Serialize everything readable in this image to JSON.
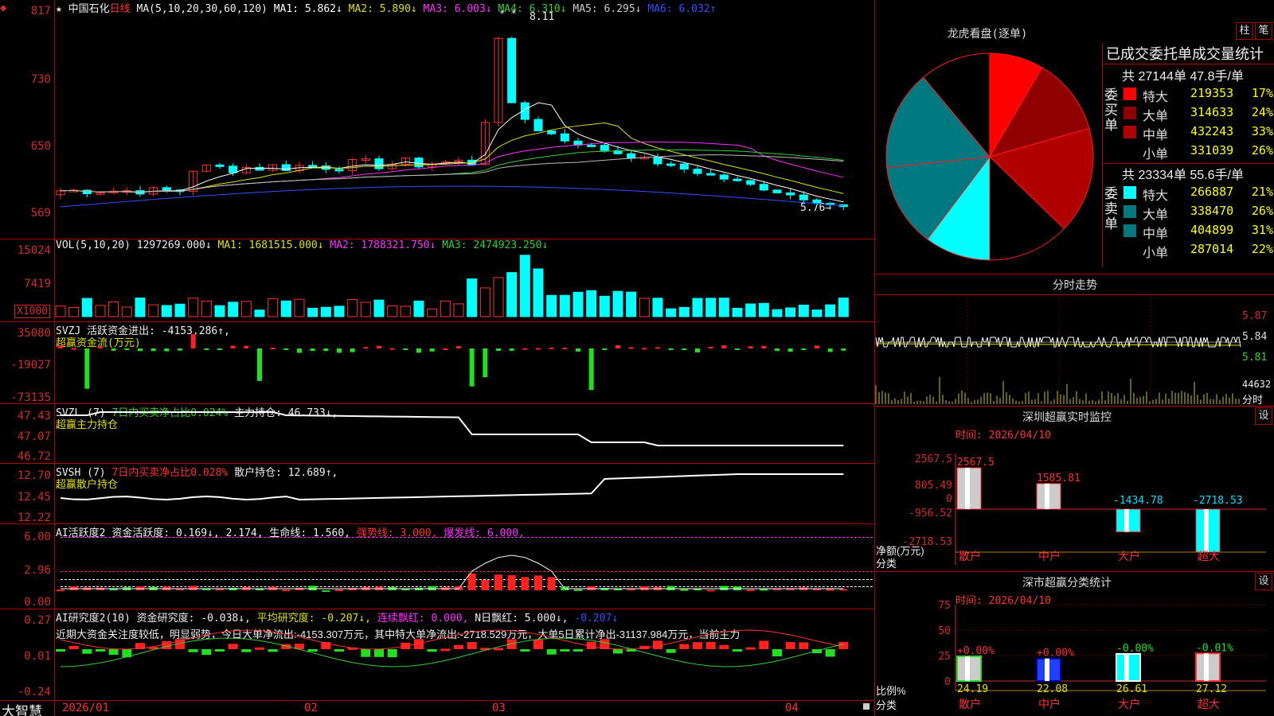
{
  "header": {
    "star": "★",
    "stock_name": "中国石化",
    "period": "日线",
    "ma_params": "MA(5,10,20,30,60,120)",
    "ma": [
      {
        "label": "MA1:",
        "value": "5.862↓",
        "color": "#ffffff"
      },
      {
        "label": "MA2:",
        "value": "5.890↓",
        "color": "#e0e000"
      },
      {
        "label": "MA3:",
        "value": "6.003↓",
        "color": "#ff30ff"
      },
      {
        "label": "MA4:",
        "value": "6.310↓",
        "color": "#30d030"
      },
      {
        "label": "MA5:",
        "value": "6.295↓",
        "color": "#cccccc"
      },
      {
        "label": "MA6:",
        "value": "6.032↑",
        "color": "#3050ff"
      }
    ],
    "high_label": "8.11",
    "low_label": "5.76→",
    "stars": "* *"
  },
  "price_axis": [
    "817",
    "730",
    "650",
    "569"
  ],
  "volume": {
    "header": "VOL(5,10,20)",
    "value": "1297269.000↓",
    "ma1": "MA1: 1681515.000↓",
    "ma2": "MA2: 1788321.750↓",
    "ma3": "MA3: 2474923.250↓",
    "axis": [
      "15024",
      "7419"
    ],
    "unit": "X1000"
  },
  "svzj": {
    "name": "SVZJ",
    "label": "活跃资金进出:",
    "value": "-4153.286↑,",
    "sub": "超赢资金流(万元)",
    "axis": [
      "35080",
      "-19027",
      "-73135"
    ]
  },
  "svzl": {
    "name": "SVZL (7)",
    "t1": "7日内买卖净占比0.024%",
    "t2": "主力持仓:",
    "v": "46.733↓,",
    "sub": "超赢主力持仓",
    "axis": [
      "47.43",
      "47.07",
      "46.72"
    ]
  },
  "svsh": {
    "name": "SVSH (7)",
    "t1": "7日内买卖净占比0.028%",
    "t2": "散户持仓:",
    "v": "12.689↑,",
    "sub": "超赢散户持仓",
    "axis": [
      "12.70",
      "12.45",
      "12.22"
    ]
  },
  "ai1": {
    "name": "AI活跃度2",
    "t1": "资金活跃度: 0.169↓,",
    "t2": "2.174,",
    "t3": "生命线: 1.560,",
    "t4": "强势线: 3.000,",
    "t5": "爆发线: 6.000,",
    "axis": [
      "6.00",
      "2.96",
      "0.00"
    ]
  },
  "ai2": {
    "name": "AI研究度2(10)",
    "t1": "资金研究度: -0.038↓,",
    "t2": "平均研究度: -0.207↓,",
    "t3": "连续飘红: 0.000,",
    "t4": "N日飘红: 5.000↓,",
    "t5": "-0.207↓",
    "axis": [
      "0.27",
      "0.01",
      "-0.24"
    ],
    "comment": "近期大资金关注度较低，明显弱势，今日大单净流出:-4153.307万元，其中特大单净流出:-2718.529万元，大单5日累计净出-31137.984万元，当前主力"
  },
  "xaxis": {
    "logo": "大智慧",
    "dates": [
      "2026/01",
      "02",
      "03",
      "04"
    ]
  },
  "dragon": {
    "title": "龙虎看盘(逐单)",
    "btn1": "柱",
    "btn2": "笔",
    "subtitle": "已成交委托单成交量统计",
    "buy": {
      "summary": "共 27144单 47.8手/单",
      "side": "委买单",
      "rows": [
        {
          "name": "特大",
          "value": "219353",
          "pct": "17%",
          "color": "#ff0000"
        },
        {
          "name": "大单",
          "value": "314633",
          "pct": "24%",
          "color": "#900000"
        },
        {
          "name": "中单",
          "value": "432243",
          "pct": "33%",
          "color": "#b00000"
        },
        {
          "name": "小单",
          "value": "331039",
          "pct": "26%",
          "color": "#000000"
        }
      ]
    },
    "sell": {
      "summary": "共 23334单 55.6手/单",
      "side": "委卖单",
      "rows": [
        {
          "name": "特大",
          "value": "266887",
          "pct": "21%",
          "color": "#00ffff"
        },
        {
          "name": "大单",
          "value": "338470",
          "pct": "26%",
          "color": "#007a80"
        },
        {
          "name": "中单",
          "value": "404899",
          "pct": "31%",
          "color": "#007a80"
        },
        {
          "name": "小单",
          "value": "287014",
          "pct": "22%",
          "color": "#000000"
        }
      ]
    }
  },
  "fenshi": {
    "title": "分时走势",
    "axis": [
      "5.87",
      "5.84",
      "5.81"
    ],
    "vol_label": "44632",
    "vol_unit": "分时"
  },
  "monitor": {
    "title": "深圳超赢实时监控",
    "btn": "设",
    "time": "时间: 2026/04/10",
    "axis": [
      "2567.5",
      "805.49",
      "0",
      "-956.52",
      "-2718.53"
    ],
    "ylabel": "净额(万元)",
    "xlabel": "分类",
    "bars": [
      {
        "cat": "散户",
        "value": 2567.5,
        "label": "2567.5"
      },
      {
        "cat": "中户",
        "value": 1585.81,
        "label": "1585.81"
      },
      {
        "cat": "大户",
        "value": -1434.78,
        "label": "-1434.78"
      },
      {
        "cat": "超大",
        "value": -2718.53,
        "label": "-2718.53"
      }
    ]
  },
  "classify": {
    "title": "深市超赢分类统计",
    "btn": "设",
    "time": "时间: 2026/04/10",
    "axis": [
      "75",
      "50",
      "25",
      "0"
    ],
    "ylabel": "比例%",
    "xlabel": "分类",
    "bars": [
      {
        "cat": "散户",
        "value": 24.19,
        "top": "+0.00%"
      },
      {
        "cat": "中户",
        "value": 22.08,
        "top": "+0.00%"
      },
      {
        "cat": "大户",
        "value": 26.61,
        "top": "-0.00%"
      },
      {
        "cat": "超大",
        "value": 27.12,
        "top": "-0.01%"
      }
    ]
  }
}
